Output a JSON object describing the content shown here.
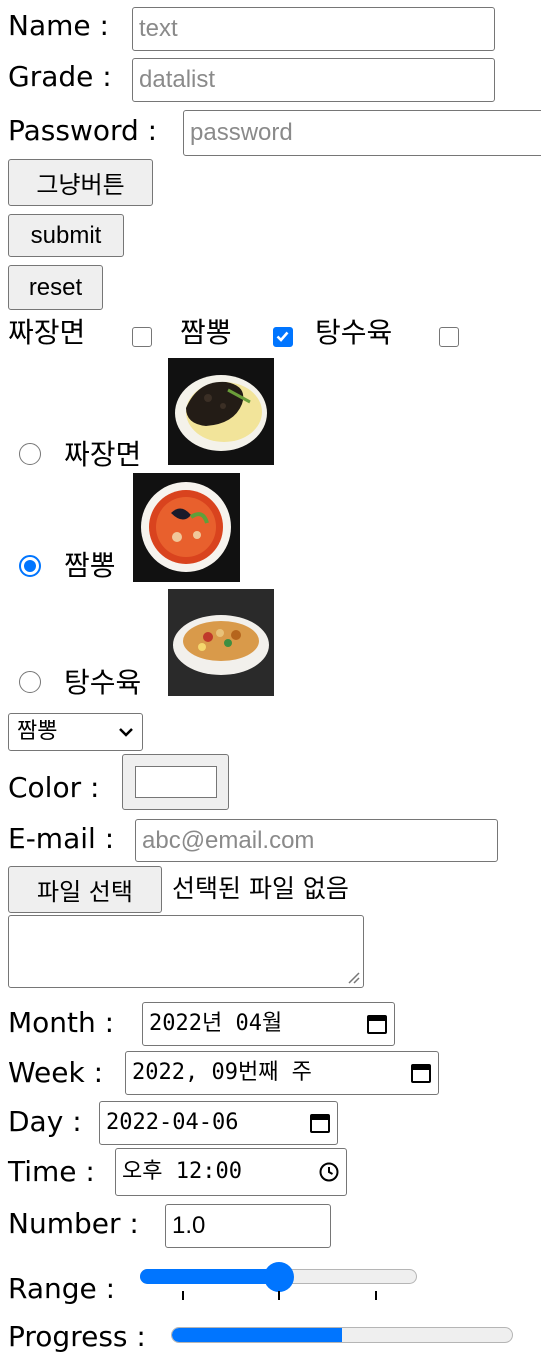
{
  "name": {
    "label": "Name :",
    "placeholder": "text"
  },
  "grade": {
    "label": "Grade :",
    "placeholder": "datalist"
  },
  "password": {
    "label": "Password :",
    "placeholder": "password"
  },
  "buttons": {
    "plain": "그냥버튼",
    "submit": "submit",
    "reset": "reset"
  },
  "checkboxes": [
    {
      "label": "짜장면",
      "checked": false
    },
    {
      "label": "짬뽕",
      "checked": true
    },
    {
      "label": "탕수육",
      "checked": false
    }
  ],
  "radios": [
    {
      "label": "짜장면",
      "checked": false,
      "image": "jajangmyeon-bowl"
    },
    {
      "label": "짬뽕",
      "checked": true,
      "image": "jjamppong-bowl"
    },
    {
      "label": "탕수육",
      "checked": false,
      "image": "tangsuyuk-plate"
    }
  ],
  "select": {
    "value": "짬뽕"
  },
  "color": {
    "label": "Color :",
    "value": "#ffffff"
  },
  "email": {
    "label": "E-mail :",
    "placeholder": "abc@email.com"
  },
  "file": {
    "button": "파일 선택",
    "status": "선택된 파일 없음"
  },
  "month": {
    "label": "Month :",
    "value": "2022년 04월"
  },
  "week": {
    "label": "Week :",
    "value": "2022, 09번째 주"
  },
  "day": {
    "label": "Day :",
    "value": "2022-04-06"
  },
  "time": {
    "label": "Time :",
    "value": "오후 12:00"
  },
  "number": {
    "label": "Number :",
    "value": "1.0"
  },
  "range": {
    "label": "Range :",
    "fraction": 0.5
  },
  "progress": {
    "label": "Progress :",
    "fraction": 0.5
  },
  "colors": {
    "accent": "#0075ff",
    "border": "#767676",
    "button_bg": "#efefef",
    "track": "#efefef"
  },
  "icons": [
    "calendar-icon",
    "clock-icon",
    "chevron-down-icon",
    "resize-grip-icon"
  ]
}
